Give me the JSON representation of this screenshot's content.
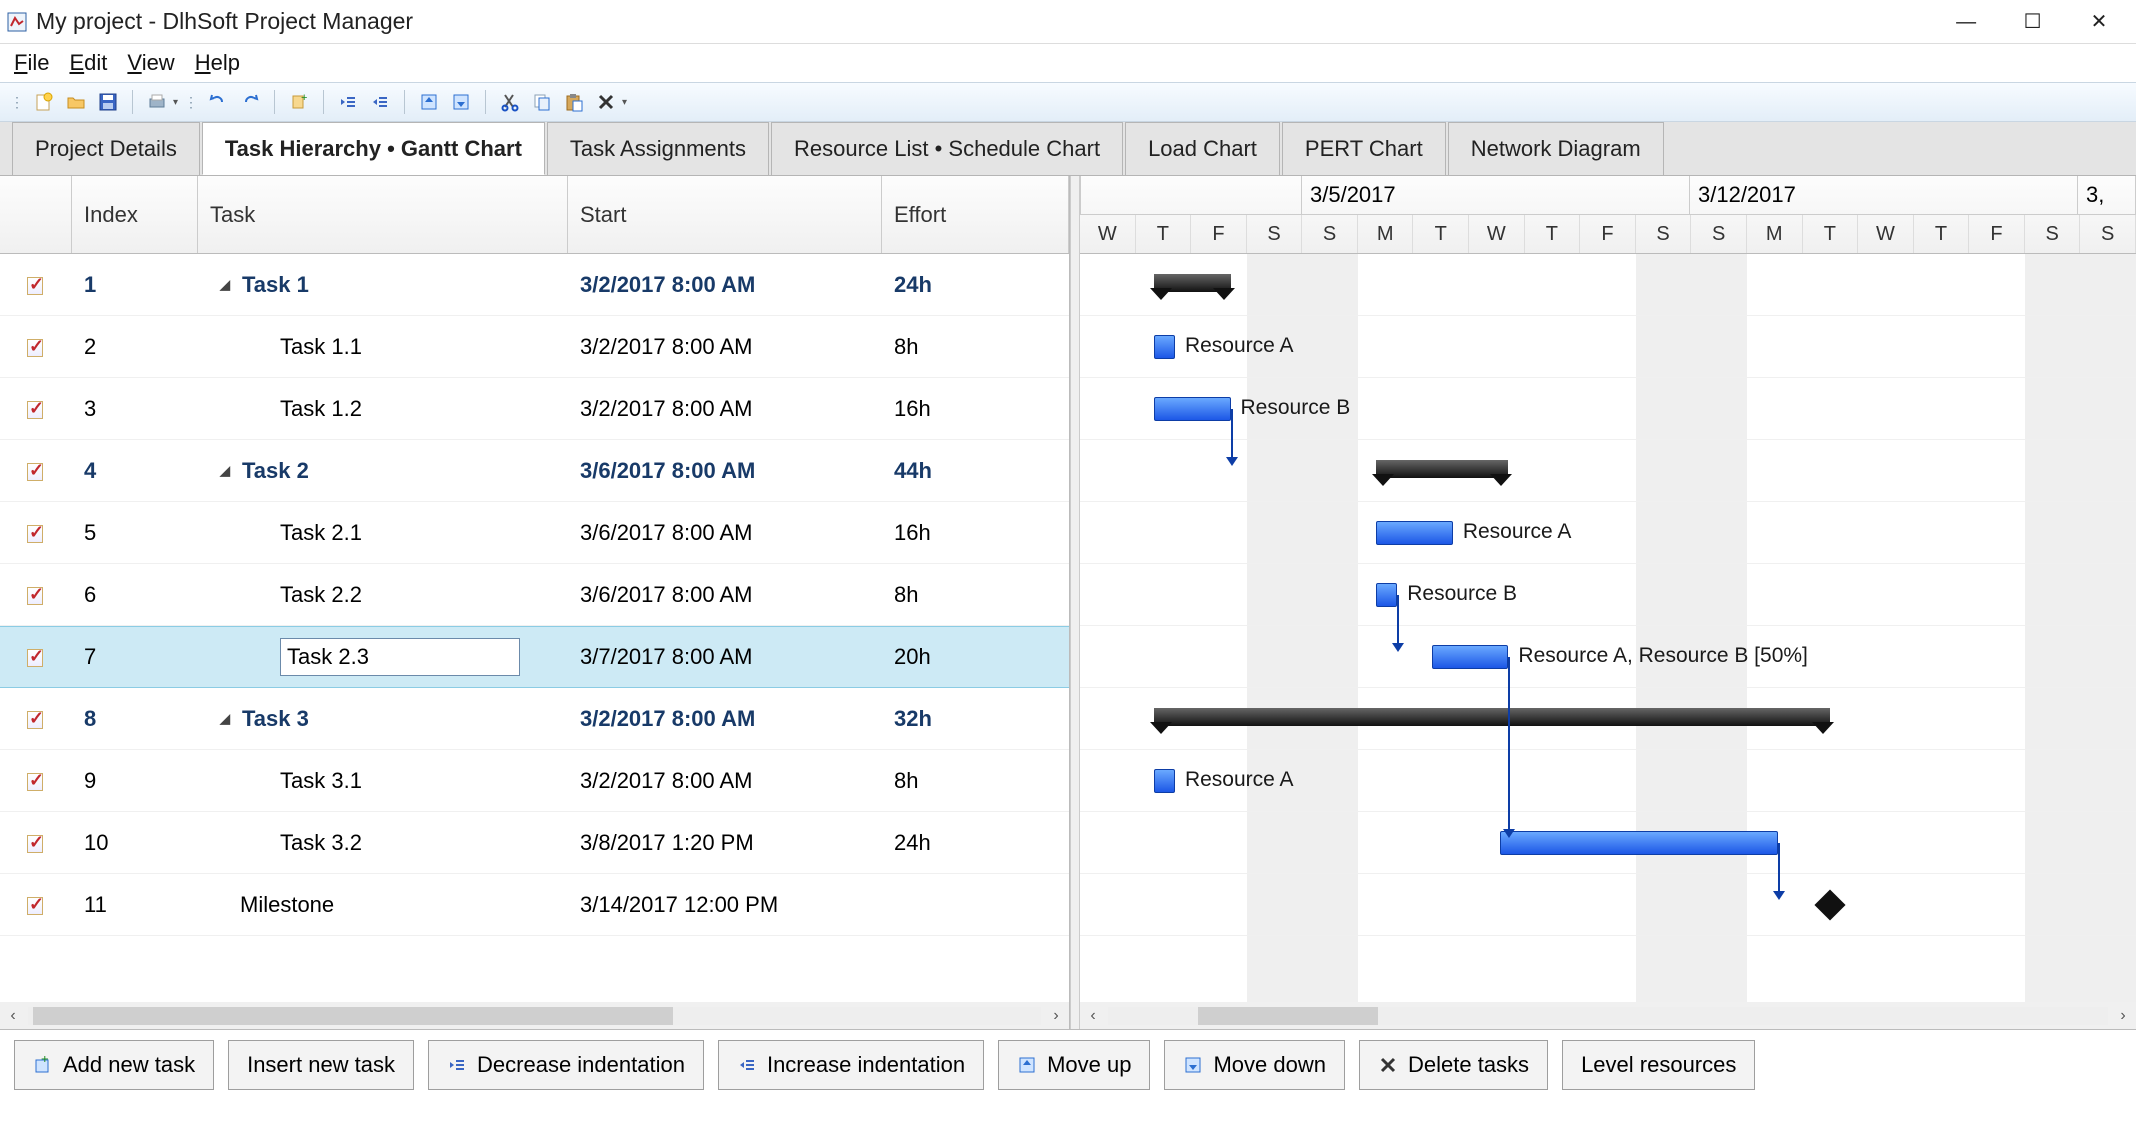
{
  "window": {
    "title": "My project - DlhSoft Project Manager"
  },
  "menu": {
    "file": "File",
    "edit": "Edit",
    "view": "View",
    "help": "Help"
  },
  "tabs": {
    "items": [
      {
        "label": "Project Details"
      },
      {
        "label": "Task Hierarchy • Gantt Chart"
      },
      {
        "label": "Task Assignments"
      },
      {
        "label": "Resource List • Schedule Chart"
      },
      {
        "label": "Load Chart"
      },
      {
        "label": "PERT Chart"
      },
      {
        "label": "Network Diagram"
      }
    ],
    "active_index": 1
  },
  "grid": {
    "columns": {
      "index": "Index",
      "task": "Task",
      "start": "Start",
      "effort": "Effort"
    },
    "rows": [
      {
        "index": "1",
        "task": "Task 1",
        "start": "3/2/2017 8:00 AM",
        "effort": "24h",
        "type": "summary",
        "indent": 0
      },
      {
        "index": "2",
        "task": "Task 1.1",
        "start": "3/2/2017 8:00 AM",
        "effort": "8h",
        "type": "task",
        "indent": 1,
        "assignments_label": "Resource A"
      },
      {
        "index": "3",
        "task": "Task 1.2",
        "start": "3/2/2017 8:00 AM",
        "effort": "16h",
        "type": "task",
        "indent": 1,
        "assignments_label": "Resource B"
      },
      {
        "index": "4",
        "task": "Task 2",
        "start": "3/6/2017 8:00 AM",
        "effort": "44h",
        "type": "summary",
        "indent": 0
      },
      {
        "index": "5",
        "task": "Task 2.1",
        "start": "3/6/2017 8:00 AM",
        "effort": "16h",
        "type": "task",
        "indent": 1,
        "assignments_label": "Resource A"
      },
      {
        "index": "6",
        "task": "Task 2.2",
        "start": "3/6/2017 8:00 AM",
        "effort": "8h",
        "type": "task",
        "indent": 1,
        "assignments_label": "Resource B"
      },
      {
        "index": "7",
        "task": "Task 2.3",
        "start": "3/7/2017 8:00 AM",
        "effort": "20h",
        "type": "task",
        "indent": 1,
        "selected": true,
        "editing": true,
        "assignments_label": "Resource A, Resource B [50%]"
      },
      {
        "index": "8",
        "task": "Task 3",
        "start": "3/2/2017 8:00 AM",
        "effort": "32h",
        "type": "summary",
        "indent": 0
      },
      {
        "index": "9",
        "task": "Task 3.1",
        "start": "3/2/2017 8:00 AM",
        "effort": "8h",
        "type": "task",
        "indent": 1,
        "assignments_label": "Resource A"
      },
      {
        "index": "10",
        "task": "Task 3.2",
        "start": "3/8/2017 1:20 PM",
        "effort": "24h",
        "type": "task",
        "indent": 1
      },
      {
        "index": "11",
        "task": "Milestone",
        "start": "3/14/2017 12:00 PM",
        "effort": "",
        "type": "milestone",
        "indent": 0
      }
    ]
  },
  "timeline": {
    "week_labels": [
      "3/5/2017",
      "3/12/2017",
      "3,"
    ],
    "day_labels": [
      "W",
      "T",
      "F",
      "S",
      "S",
      "M",
      "T",
      "W",
      "T",
      "F",
      "S",
      "S",
      "M",
      "T",
      "W",
      "T",
      "F",
      "S",
      "S"
    ]
  },
  "bottom": {
    "add_new_task": "Add new task",
    "insert_new_task": "Insert new task",
    "decrease_indent": "Decrease indentation",
    "increase_indent": "Increase indentation",
    "move_up": "Move up",
    "move_down": "Move down",
    "delete_tasks": "Delete tasks",
    "level_resources": "Level resources"
  },
  "chart_data": {
    "type": "gantt",
    "title": "Task Hierarchy • Gantt Chart",
    "visible_range": {
      "start": "3/1/2017",
      "end": "3/19/2017"
    },
    "tasks": [
      {
        "id": 1,
        "name": "Task 1",
        "type": "summary",
        "start": "3/2/2017 08:00",
        "finish": "3/3/2017 17:00",
        "effort_h": 24
      },
      {
        "id": 2,
        "name": "Task 1.1",
        "type": "task",
        "start": "3/2/2017 08:00",
        "finish": "3/2/2017 17:00",
        "effort_h": 8,
        "assignments": [
          "Resource A"
        ]
      },
      {
        "id": 3,
        "name": "Task 1.2",
        "type": "task",
        "start": "3/2/2017 08:00",
        "finish": "3/3/2017 17:00",
        "effort_h": 16,
        "assignments": [
          "Resource B"
        ]
      },
      {
        "id": 4,
        "name": "Task 2",
        "type": "summary",
        "start": "3/6/2017 08:00",
        "finish": "3/8/2017 17:00",
        "effort_h": 44
      },
      {
        "id": 5,
        "name": "Task 2.1",
        "type": "task",
        "start": "3/6/2017 08:00",
        "finish": "3/7/2017 17:00",
        "effort_h": 16,
        "assignments": [
          "Resource A"
        ]
      },
      {
        "id": 6,
        "name": "Task 2.2",
        "type": "task",
        "start": "3/6/2017 08:00",
        "finish": "3/6/2017 17:00",
        "effort_h": 8,
        "assignments": [
          "Resource B"
        ]
      },
      {
        "id": 7,
        "name": "Task 2.3",
        "type": "task",
        "start": "3/7/2017 08:00",
        "finish": "3/8/2017 17:00",
        "effort_h": 20,
        "assignments": [
          "Resource A",
          "Resource B [50%]"
        ]
      },
      {
        "id": 8,
        "name": "Task 3",
        "type": "summary",
        "start": "3/2/2017 08:00",
        "finish": "3/14/2017 12:00",
        "effort_h": 32
      },
      {
        "id": 9,
        "name": "Task 3.1",
        "type": "task",
        "start": "3/2/2017 08:00",
        "finish": "3/2/2017 17:00",
        "effort_h": 8,
        "assignments": [
          "Resource A"
        ]
      },
      {
        "id": 10,
        "name": "Task 3.2",
        "type": "task",
        "start": "3/8/2017 13:20",
        "finish": "3/13/2017 13:20",
        "effort_h": 24
      },
      {
        "id": 11,
        "name": "Milestone",
        "type": "milestone",
        "start": "3/14/2017 12:00",
        "finish": "3/14/2017 12:00",
        "effort_h": 0
      }
    ],
    "dependencies": [
      {
        "from": 3,
        "to": 4
      },
      {
        "from": 6,
        "to": 7
      },
      {
        "from": 7,
        "to": 10
      },
      {
        "from": 10,
        "to": 11
      }
    ]
  }
}
